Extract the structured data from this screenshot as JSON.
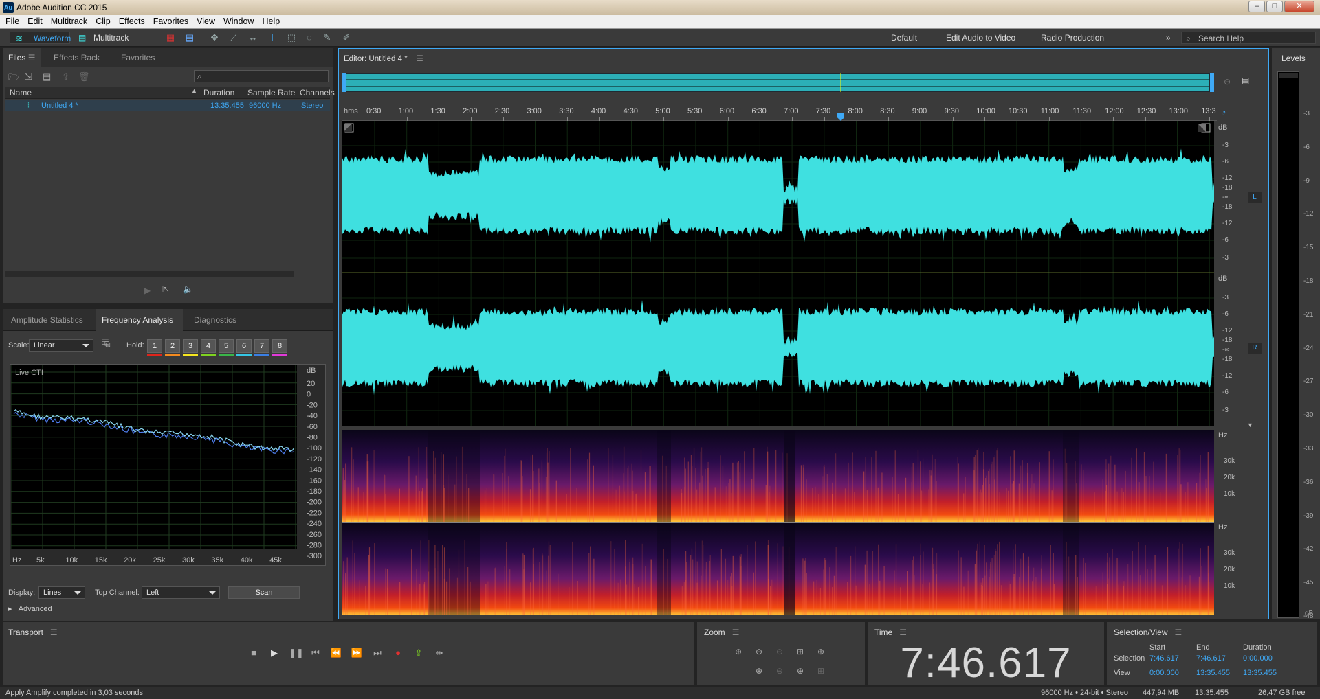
{
  "app": {
    "title": "Adobe Audition CC 2015",
    "icon_text": "Au"
  },
  "window_controls": [
    "–",
    "□",
    "✕"
  ],
  "menu": [
    "File",
    "Edit",
    "Multitrack",
    "Clip",
    "Effects",
    "Favorites",
    "View",
    "Window",
    "Help"
  ],
  "toolbar": {
    "waveform": "Waveform",
    "multitrack": "Multitrack",
    "workspaces": [
      "Default",
      "Edit Audio to Video",
      "Radio Production"
    ],
    "more": "»",
    "search_placeholder": "Search Help"
  },
  "files_panel": {
    "tabs": [
      "Files",
      "Effects Rack",
      "Favorites"
    ],
    "columns": [
      "Name",
      "Duration",
      "Sample Rate",
      "Channels"
    ],
    "rows": [
      {
        "name": "Untitled 4 *",
        "duration": "13:35.455",
        "sample_rate": "96000 Hz",
        "channels": "Stereo"
      }
    ]
  },
  "analysis_panel": {
    "tabs": [
      "Amplitude Statistics",
      "Frequency Analysis",
      "Diagnostics"
    ],
    "scale_label": "Scale:",
    "scale_value": "Linear",
    "hold_label": "Hold:",
    "hold_buttons": [
      "1",
      "2",
      "3",
      "4",
      "5",
      "6",
      "7",
      "8"
    ],
    "hold_colors": [
      "#e0241b",
      "#f58a1f",
      "#f5e51f",
      "#7fd320",
      "#3ab549",
      "#35c6e5",
      "#3a7fe5",
      "#e23ad9"
    ],
    "live_cti": "Live CTI",
    "db_unit": "dB",
    "db_ticks": [
      "20",
      "0",
      "-20",
      "-40",
      "-60",
      "-80",
      "-100",
      "-120",
      "-140",
      "-160",
      "-180",
      "-200",
      "-220",
      "-240",
      "-260",
      "-280",
      "-300"
    ],
    "hz_unit": "Hz",
    "hz_ticks": [
      "5k",
      "10k",
      "15k",
      "20k",
      "25k",
      "30k",
      "35k",
      "40k",
      "45k"
    ],
    "display_label": "Display:",
    "display_value": "Lines",
    "top_channel_label": "Top Channel:",
    "top_channel_value": "Left",
    "scan": "Scan",
    "advanced": "Advanced"
  },
  "editor": {
    "title": "Editor: Untitled 4 *",
    "ruler_unit": "hms",
    "ruler_ticks": [
      "0:30",
      "1:00",
      "1:30",
      "2:00",
      "2:30",
      "3:00",
      "3:30",
      "4:00",
      "4:30",
      "5:00",
      "5:30",
      "6:00",
      "6:30",
      "7:00",
      "7:30",
      "8:00",
      "8:30",
      "9:00",
      "9:30",
      "10:00",
      "10:30",
      "11:00",
      "11:30",
      "12:00",
      "12:30",
      "13:00",
      "13:3"
    ],
    "db_unit": "dB",
    "db_scale": [
      "-3",
      "-6",
      "-12",
      "-18",
      "-∞",
      "-18",
      "-12",
      "-6",
      "-3"
    ],
    "channel_left": "L",
    "channel_right": "R",
    "hz_unit": "Hz",
    "hz_scale": [
      "30k",
      "20k",
      "10k"
    ],
    "waveform_color": "#3fe0e0"
  },
  "levels": {
    "title": "Levels",
    "ticks": [
      "-3",
      "-6",
      "-9",
      "-12",
      "-15",
      "-18",
      "-21",
      "-24",
      "-27",
      "-30",
      "-33",
      "-36",
      "-39",
      "-42",
      "-45",
      "-48"
    ],
    "bottom": "dB"
  },
  "transport": {
    "title": "Transport"
  },
  "zoom": {
    "title": "Zoom"
  },
  "time": {
    "title": "Time",
    "value": "7:46.617"
  },
  "selection_view": {
    "title": "Selection/View",
    "headers": [
      "Start",
      "End",
      "Duration"
    ],
    "selection_label": "Selection",
    "selection": [
      "7:46.617",
      "7:46.617",
      "0:00.000"
    ],
    "view_label": "View",
    "view": [
      "0:00.000",
      "13:35.455",
      "13:35.455"
    ]
  },
  "status": {
    "message": "Apply Amplify completed in 3,03 seconds",
    "format": "96000 Hz • 24-bit • Stereo",
    "size": "447,94 MB",
    "duration": "13:35.455",
    "free": "26,47 GB free"
  }
}
